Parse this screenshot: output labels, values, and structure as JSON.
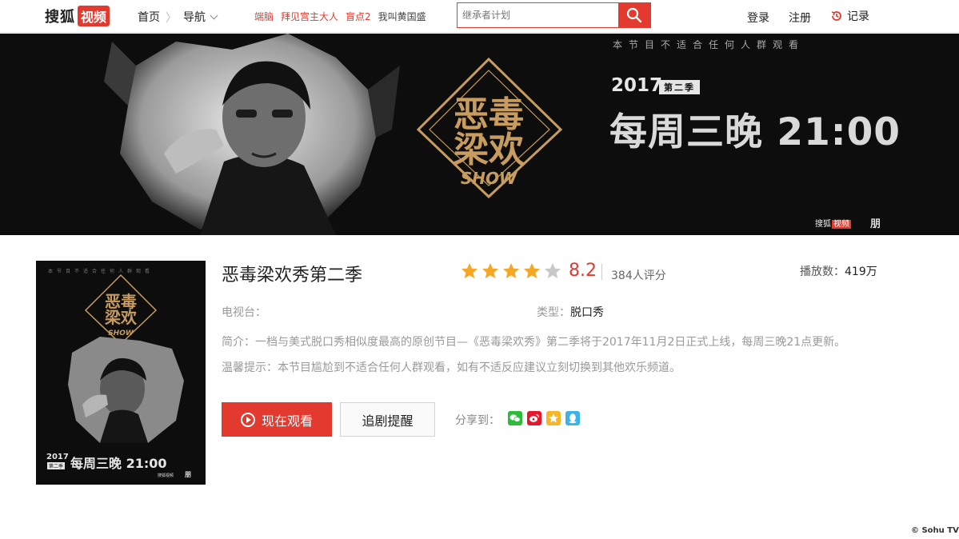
{
  "header": {
    "logo_text": "搜狐",
    "logo_box": "视频",
    "nav_home": "首页",
    "nav_sep": "〉",
    "nav_guide": "导航",
    "hot_links": [
      {
        "label": "端脑",
        "style": "red"
      },
      {
        "label": "拜见宫主大人",
        "style": "red"
      },
      {
        "label": "盲点2",
        "style": "red"
      },
      {
        "label": "我叫黄国盛",
        "style": "plain"
      }
    ],
    "search_placeholder": "继承者计划",
    "login_label": "登录",
    "register_label": "注册",
    "history_label": "记录"
  },
  "banner": {
    "disclaimer": "本节目不适合任何人群观看",
    "year": "2017",
    "season": "第二季",
    "schedule": "每周三晚 21:00",
    "logo_line1": "恶毒",
    "logo_line2": "梁欢",
    "logo_show": "SHOW",
    "sohu_text": "搜狐",
    "sohu_box": "视频",
    "peng": "朋"
  },
  "poster": {
    "disclaimer": "本节目不适合任何人群观看",
    "year": "2017",
    "season": "第二季",
    "schedule": "每周三晚 21:00",
    "logo_show": "SHOW",
    "sohu": "搜狐视频",
    "peng": "朋"
  },
  "show": {
    "title": "恶毒梁欢秀第二季",
    "rating_stars": 4,
    "rating_stars_max": 5,
    "score": "8.2",
    "rating_count": "384人评分",
    "plays_label": "播放数：",
    "plays_value": "419万",
    "station_label": "电视台：",
    "genre_label": "类型：",
    "genre_value": "脱口秀",
    "synopsis": "简介：一档与美式脱口秀相似度最高的原创节目—《恶毒梁欢秀》第二季将于2017年11月2日正式上线，每周三晚21点更新。",
    "tip": "温馨提示：本节目尴尬到不适合任何人群观看，如有不适反应建议立刻切换到其他欢乐频道。"
  },
  "actions": {
    "watch_label": "现在观看",
    "follow_label": "追剧提醒",
    "share_label": "分享到：",
    "share_icons": [
      "wechat-icon",
      "weibo-icon",
      "qzone-icon",
      "qq-icon"
    ]
  },
  "colors": {
    "accent": "#e23a2e",
    "star_on": "#f5a623",
    "star_off": "#c8c8c8",
    "wechat": "#2dbb3a",
    "weibo": "#e6162d",
    "qzone": "#f7b52a",
    "qq": "#3cb3e8"
  },
  "credit": "© Sohu TV"
}
